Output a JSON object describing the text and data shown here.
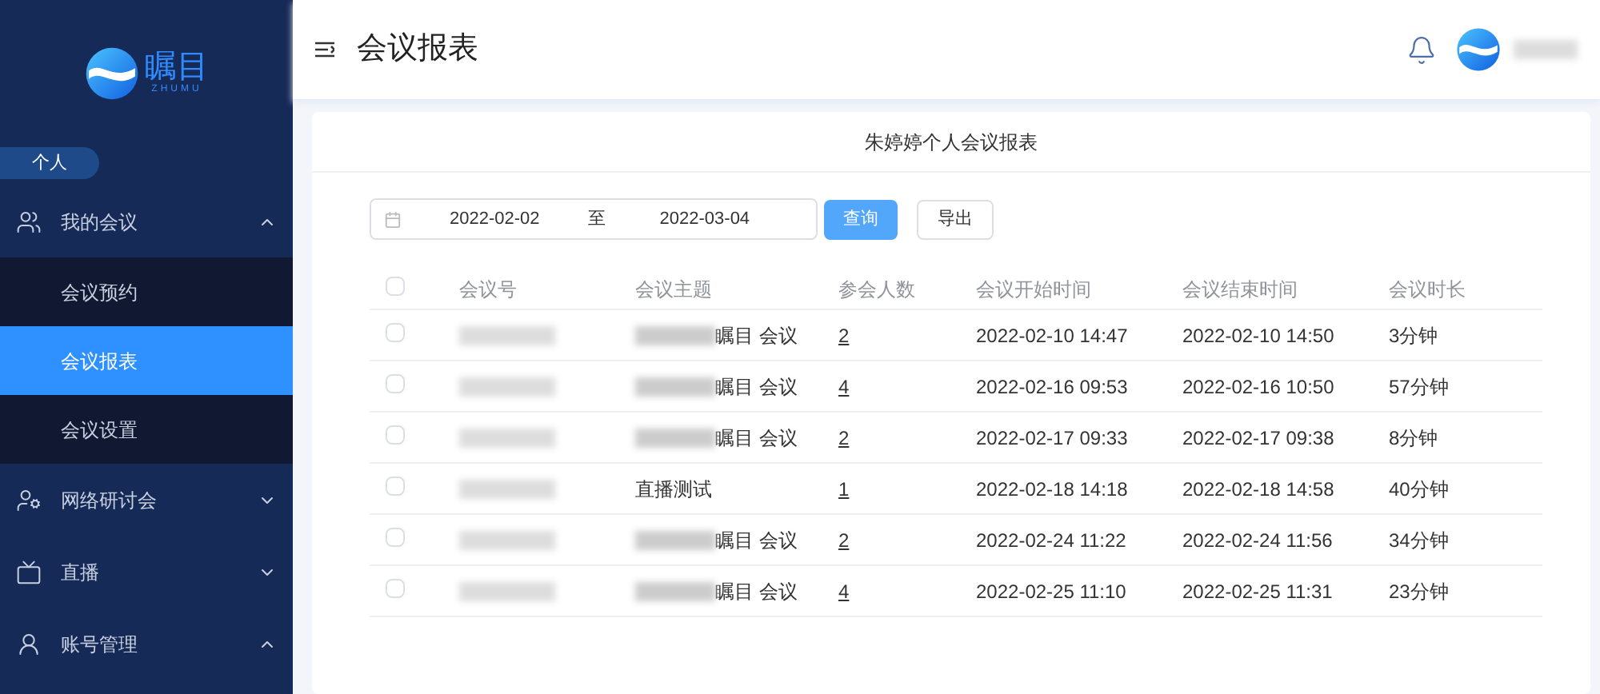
{
  "sidebar": {
    "logo": {
      "name": "瞩目",
      "sub": "ZHUMU"
    },
    "section": "个人",
    "items": [
      {
        "label": "我的会议",
        "expanded": true,
        "children": [
          {
            "label": "会议预约",
            "selected": false
          },
          {
            "label": "会议报表",
            "selected": true
          },
          {
            "label": "会议设置",
            "selected": false
          }
        ]
      },
      {
        "label": "网络研讨会",
        "expanded": false
      },
      {
        "label": "直播",
        "expanded": false
      },
      {
        "label": "账号管理",
        "expanded": true
      }
    ]
  },
  "header": {
    "title": "会议报表"
  },
  "report": {
    "title": "朱婷婷个人会议报表",
    "date_from": "2022-02-02",
    "separator": "至",
    "date_to": "2022-03-04",
    "buttons": [
      {
        "label": "查询",
        "kind": "primary"
      },
      {
        "label": "导出",
        "kind": "default"
      }
    ],
    "table": {
      "columns": [
        "会议号",
        "会议主题",
        "参会人数",
        "会议开始时间",
        "会议结束时间",
        "会议时长"
      ],
      "all_checked": false,
      "rows": [
        {
          "checked": false,
          "topic": "瞩目 会议",
          "topic_redacted": true,
          "participants": "2",
          "start": "2022-02-10 14:47",
          "end": "2022-02-10 14:50",
          "duration": "3分钟"
        },
        {
          "checked": false,
          "topic": "瞩目 会议",
          "topic_redacted": true,
          "participants": "4",
          "start": "2022-02-16 09:53",
          "end": "2022-02-16 10:50",
          "duration": "57分钟"
        },
        {
          "checked": false,
          "topic": "瞩目 会议",
          "topic_redacted": true,
          "participants": "2",
          "start": "2022-02-17 09:33",
          "end": "2022-02-17 09:38",
          "duration": "8分钟"
        },
        {
          "checked": false,
          "topic": "直播测试",
          "topic_redacted": false,
          "participants": "1",
          "start": "2022-02-18 14:18",
          "end": "2022-02-18 14:58",
          "duration": "40分钟"
        },
        {
          "checked": false,
          "topic": "瞩目 会议",
          "topic_redacted": true,
          "participants": "2",
          "start": "2022-02-24 11:22",
          "end": "2022-02-24 11:56",
          "duration": "34分钟"
        },
        {
          "checked": false,
          "topic": "瞩目 会议",
          "topic_redacted": true,
          "participants": "4",
          "start": "2022-02-25 11:10",
          "end": "2022-02-25 11:31",
          "duration": "23分钟"
        }
      ]
    }
  }
}
